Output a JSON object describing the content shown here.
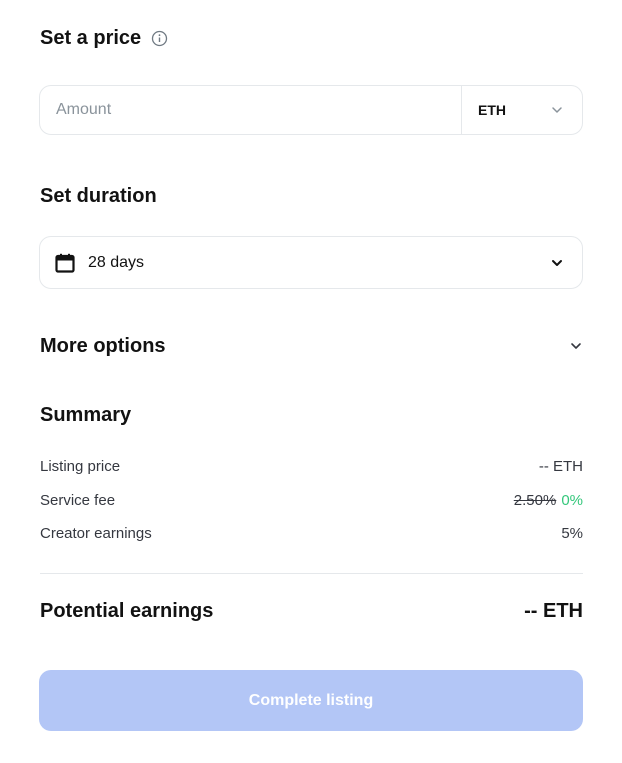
{
  "price": {
    "title": "Set a price",
    "amount_placeholder": "Amount",
    "amount_value": "",
    "currency": "ETH"
  },
  "duration": {
    "title": "Set duration",
    "value": "28 days"
  },
  "more_options": {
    "label": "More options"
  },
  "summary": {
    "title": "Summary",
    "listing_price_label": "Listing price",
    "listing_price_value": "-- ETH",
    "service_fee_label": "Service fee",
    "service_fee_old": "2.50%",
    "service_fee_new": "0%",
    "creator_earnings_label": "Creator earnings",
    "creator_earnings_value": "5%"
  },
  "earnings": {
    "label": "Potential earnings",
    "value": "-- ETH"
  },
  "actions": {
    "complete_label": "Complete listing"
  },
  "colors": {
    "accent_disabled": "#b3c6f6",
    "fee_green": "#34c77b",
    "border": "#e5e8eb"
  },
  "icons": {
    "info": "info-icon",
    "calendar": "calendar-icon",
    "chevron": "chevron-down-icon"
  }
}
